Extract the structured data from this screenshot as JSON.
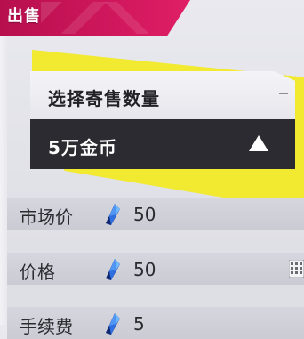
{
  "header": {
    "title": "出售"
  },
  "panel": {
    "heading": "选择寄售数量",
    "selected_amount": "5万金币"
  },
  "rows": [
    {
      "label": "市场价",
      "icon": "diamond-icon",
      "value": "50"
    },
    {
      "label": "价格",
      "icon": "diamond-icon",
      "value": "50"
    },
    {
      "label": "手续费",
      "icon": "diamond-icon",
      "value": "5"
    }
  ],
  "colors": {
    "header_accent": "#d2185e",
    "highlight_yellow": "#f1ea31",
    "select_bg": "#2b2b31",
    "gem_blue": "#2f6fe0"
  }
}
